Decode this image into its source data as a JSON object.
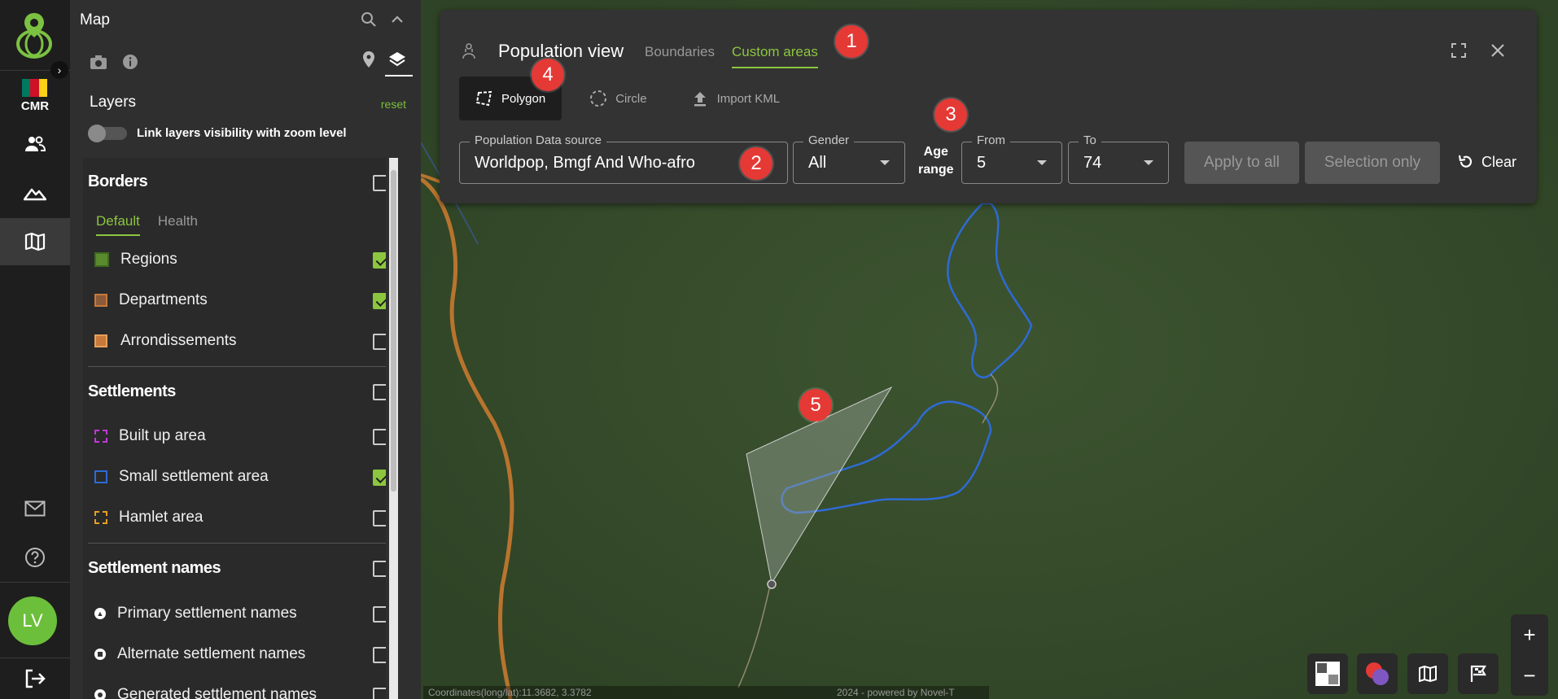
{
  "rail": {
    "country_code": "CMR",
    "avatar_initials": "LV",
    "flag_colors": [
      "#007a5e",
      "#ce1126",
      "#fcd116"
    ],
    "icons": [
      "users-icon",
      "terrain-icon",
      "map-icon",
      "mail-icon",
      "help-icon",
      "logout-icon"
    ]
  },
  "panel": {
    "title": "Map",
    "layers_heading": "Layers",
    "reset_label": "reset",
    "link_toggle_label": "Link layers visibility with zoom level",
    "sections": {
      "borders": {
        "title": "Borders",
        "tabs": [
          "Default",
          "Health"
        ],
        "items": [
          {
            "label": "Regions",
            "checked": true
          },
          {
            "label": "Departments",
            "checked": true
          },
          {
            "label": "Arrondissements",
            "checked": false
          }
        ]
      },
      "settlements": {
        "title": "Settlements",
        "items": [
          {
            "label": "Built up area",
            "checked": false
          },
          {
            "label": "Small settlement area",
            "checked": true
          },
          {
            "label": "Hamlet area",
            "checked": false
          }
        ]
      },
      "settlement_names": {
        "title": "Settlement names",
        "items": [
          {
            "label": "Primary settlement names",
            "checked": false
          },
          {
            "label": "Alternate settlement names",
            "checked": false
          },
          {
            "label": "Generated settlement names",
            "checked": false
          }
        ]
      }
    }
  },
  "population": {
    "title": "Population view",
    "tabs": [
      {
        "label": "Boundaries",
        "active": false
      },
      {
        "label": "Custom areas",
        "active": true
      }
    ],
    "draw_buttons": [
      "Polygon",
      "Circle",
      "Import KML"
    ],
    "data_source_label": "Population Data source",
    "data_source_value": "Worldpop, Bmgf And Who-afro",
    "gender_label": "Gender",
    "gender_value": "All",
    "age_range_label_1": "Age",
    "age_range_label_2": "range",
    "from_label": "From",
    "from_value": "5",
    "to_label": "To",
    "to_value": "74",
    "apply_all_label": "Apply to all",
    "selection_only_label": "Selection only",
    "clear_label": "Clear"
  },
  "badges": [
    "1",
    "2",
    "3",
    "4",
    "5"
  ],
  "map": {
    "zoom_in": "+",
    "zoom_out": "−",
    "footer_coords": "Coordinates(long/lat):11.3682, 3.3782",
    "footer_credit": "2024 - powered by Novel-T"
  },
  "colors": {
    "accent_green": "#8cc63f",
    "badge_red": "#e53935",
    "settlement_blue": "#2e6bd6",
    "road_orange": "#c8793a"
  }
}
